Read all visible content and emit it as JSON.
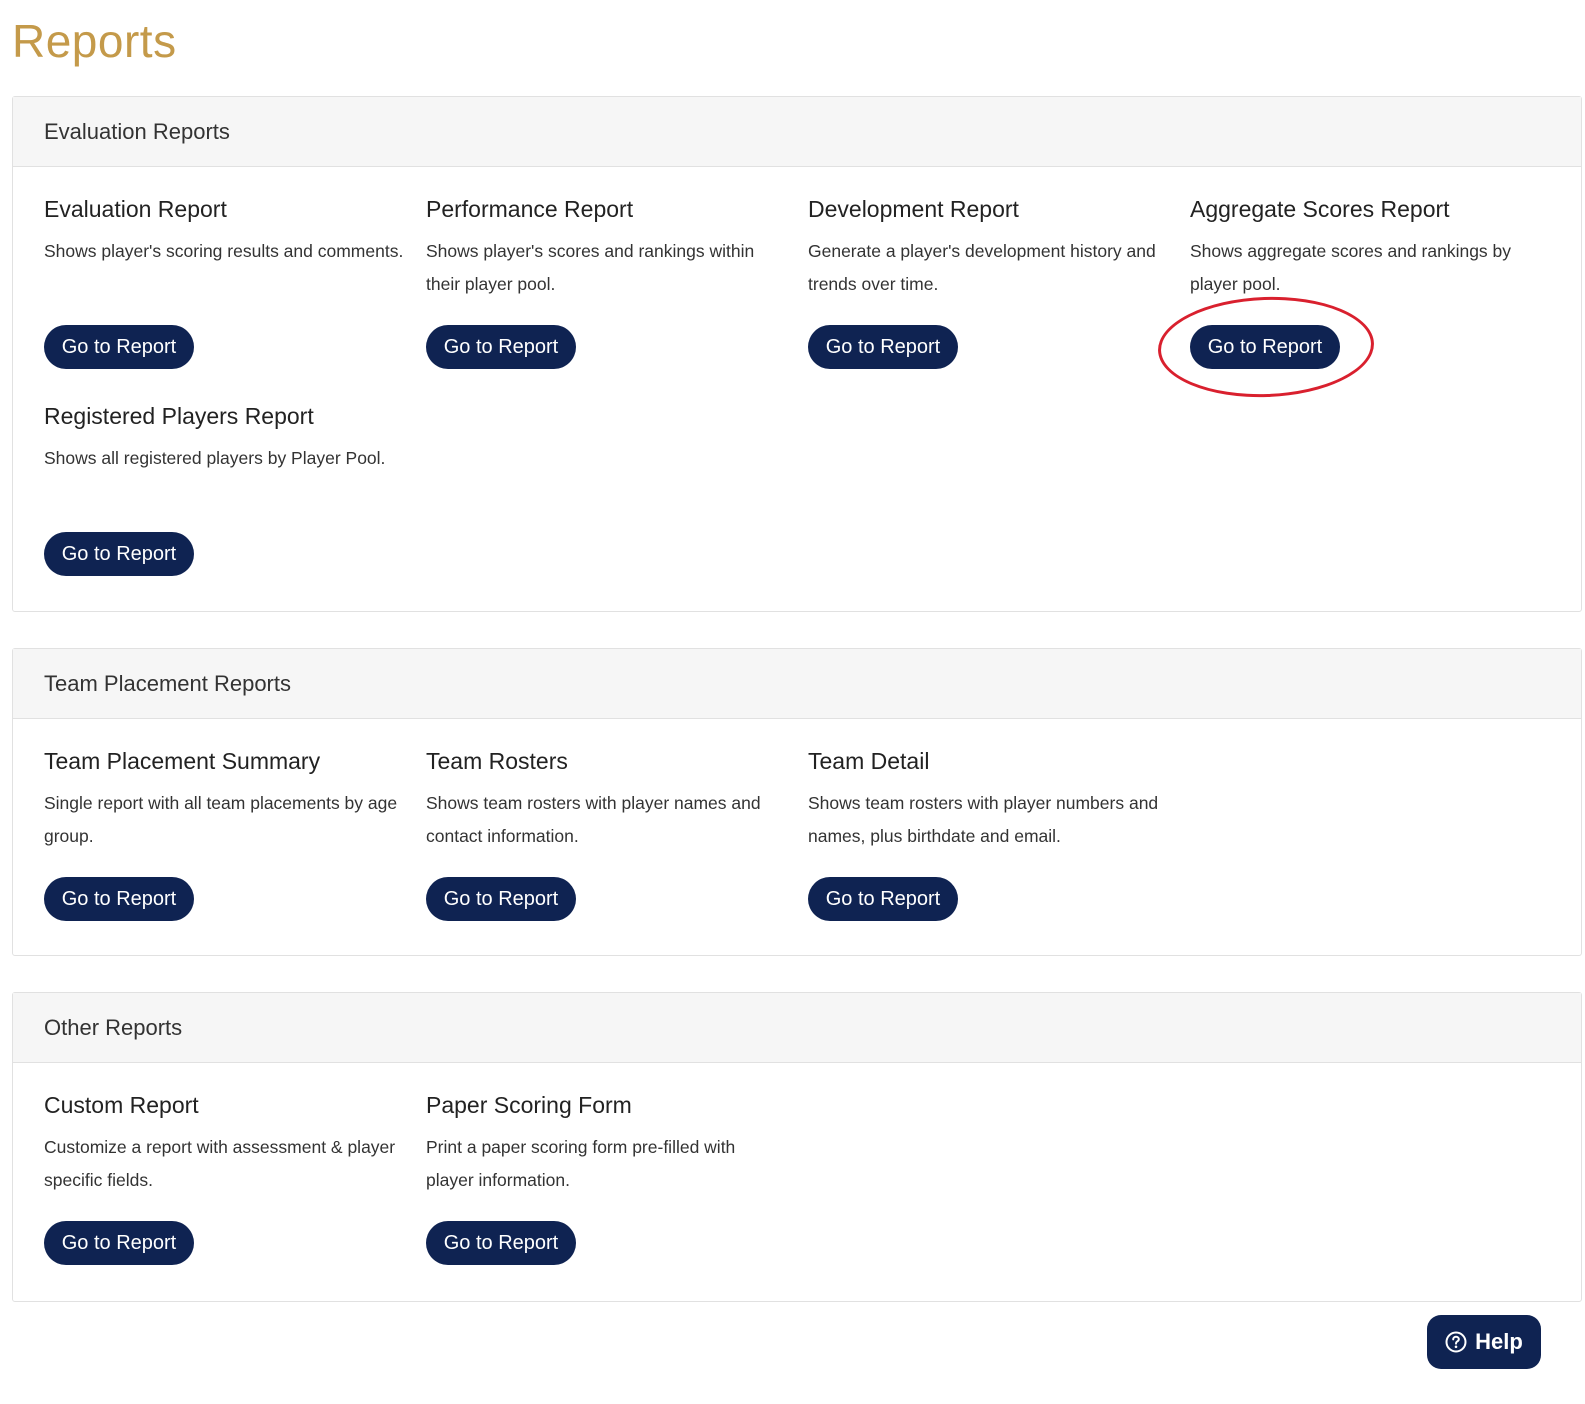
{
  "page": {
    "title": "Reports"
  },
  "colors": {
    "title": "#c49a4a",
    "button": "#0f2352",
    "highlight": "#d9202e",
    "header_bg": "#f6f6f6"
  },
  "sections": [
    {
      "title": "Evaluation Reports",
      "reports": [
        {
          "title": "Evaluation Report",
          "desc": "Shows player's scoring results and comments.",
          "button": "Go to Report"
        },
        {
          "title": "Performance Report",
          "desc": "Shows player's scores and rankings within their player pool.",
          "button": "Go to Report"
        },
        {
          "title": "Development Report",
          "desc": "Generate a player's development history and trends over time.",
          "button": "Go to Report"
        },
        {
          "title": "Aggregate Scores Report",
          "desc": "Shows aggregate scores and rankings by player pool.",
          "button": "Go to Report"
        },
        {
          "title": "Registered Players Report",
          "desc": "Shows all registered players by Player Pool.",
          "button": "Go to Report"
        }
      ]
    },
    {
      "title": "Team Placement Reports",
      "reports": [
        {
          "title": "Team Placement Summary",
          "desc": "Single report with all team placements by age group.",
          "button": "Go to Report"
        },
        {
          "title": "Team Rosters",
          "desc": "Shows team rosters with player names and contact information.",
          "button": "Go to Report"
        },
        {
          "title": "Team Detail",
          "desc": "Shows team rosters with player numbers and names, plus birthdate and email.",
          "button": "Go to Report"
        }
      ]
    },
    {
      "title": "Other Reports",
      "reports": [
        {
          "title": "Custom Report",
          "desc": "Customize a report with assessment & player specific fields.",
          "button": "Go to Report"
        },
        {
          "title": "Paper Scoring Form",
          "desc": "Print a paper scoring form pre-filled with player information.",
          "button": "Go to Report"
        }
      ]
    }
  ],
  "help": {
    "label": "Help",
    "icon": "question-circle-icon"
  }
}
